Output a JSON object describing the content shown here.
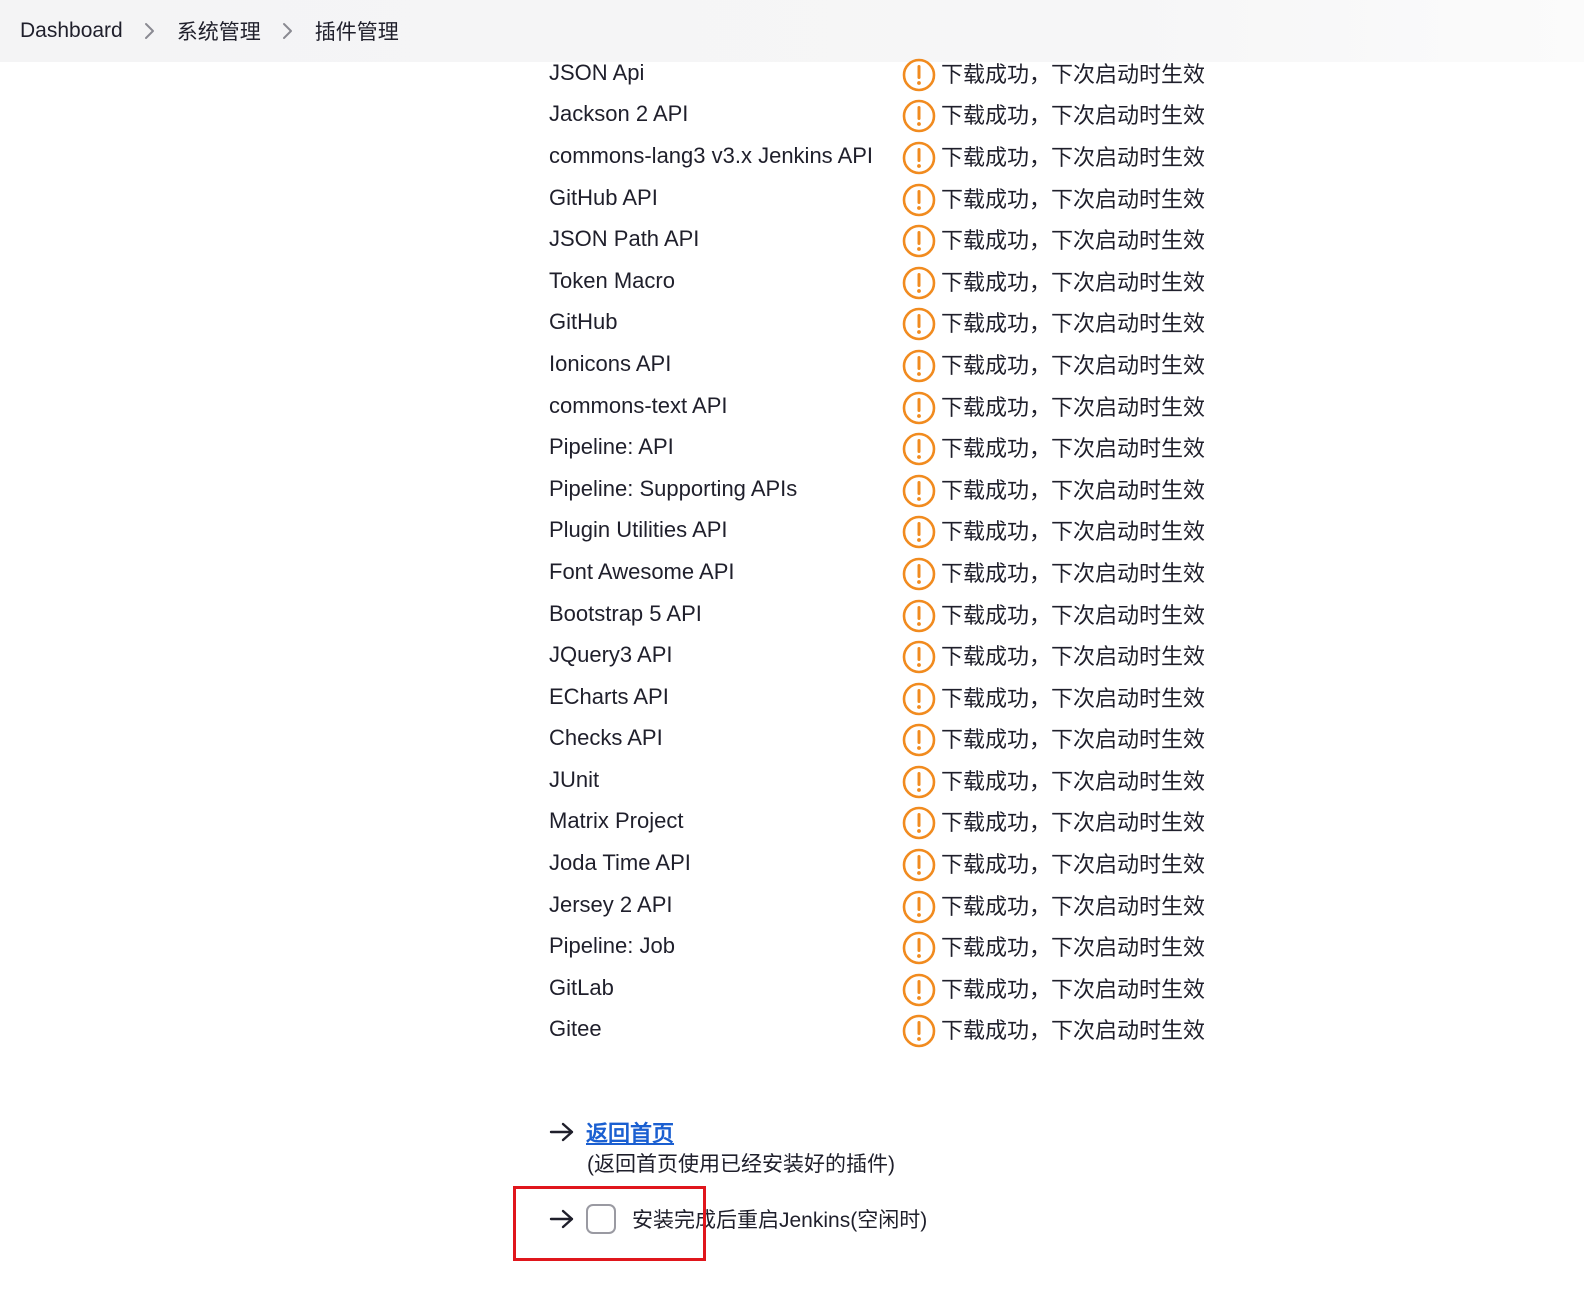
{
  "breadcrumb": {
    "items": [
      "Dashboard",
      "系统管理",
      "插件管理"
    ]
  },
  "status_message": "下载成功，下次启动时生效",
  "status_color": "#f18b1f",
  "plugins": [
    "JSON Api",
    "Jackson 2 API",
    "commons-lang3 v3.x Jenkins API",
    "GitHub API",
    "JSON Path API",
    "Token Macro",
    "GitHub",
    "Ionicons API",
    "commons-text API",
    "Pipeline: API",
    "Pipeline: Supporting APIs",
    "Plugin Utilities API",
    "Font Awesome API",
    "Bootstrap 5 API",
    "JQuery3 API",
    "ECharts API",
    "Checks API",
    "JUnit",
    "Matrix Project",
    "Joda Time API",
    "Jersey 2 API",
    "Pipeline: Job",
    "GitLab",
    "Gitee"
  ],
  "actions": {
    "home_link": "返回首页",
    "home_desc": "(返回首页使用已经安装好的插件)",
    "restart_label": "安装完成后重启Jenkins(空闲时)",
    "restart_checked": false
  },
  "icons": {
    "status": "warning-circle-icon",
    "separator": "chevron-right-icon",
    "action": "arrow-right-icon"
  },
  "colors": {
    "link": "#1a5fd1",
    "highlight": "#e0161c"
  }
}
